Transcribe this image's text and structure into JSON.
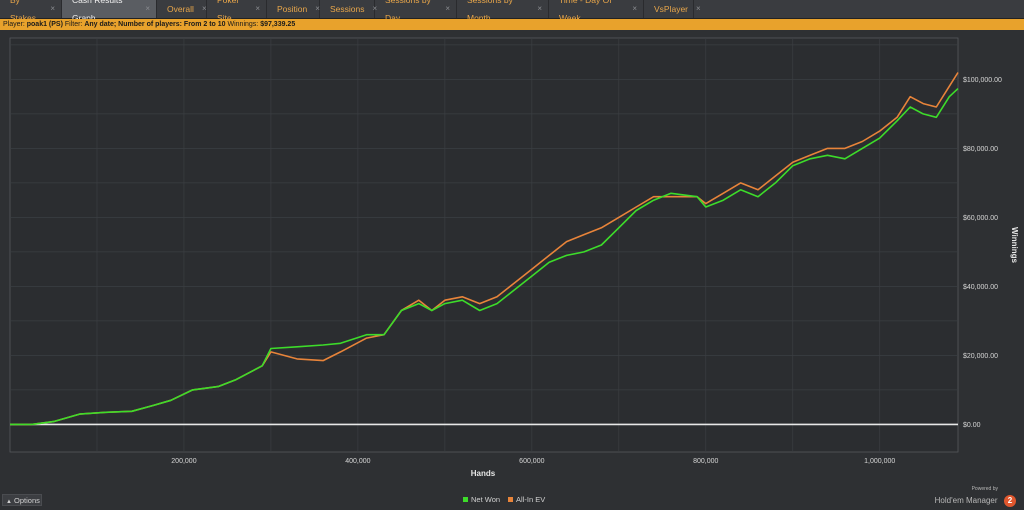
{
  "tabs": [
    {
      "label": "By Stakes",
      "w": 62
    },
    {
      "label": "Cash Results Graph",
      "w": 95,
      "active": true
    },
    {
      "label": "Overall",
      "w": 50
    },
    {
      "label": "Poker Site",
      "w": 60
    },
    {
      "label": "Position",
      "w": 53
    },
    {
      "label": "Sessions",
      "w": 55
    },
    {
      "label": "Sessions by Day",
      "w": 82
    },
    {
      "label": "Sessions by Month",
      "w": 92
    },
    {
      "label": "Time - Day Of Week",
      "w": 95
    },
    {
      "label": "VsPlayer",
      "w": 50
    }
  ],
  "filter": {
    "player_label": "Player:",
    "player": "poak1 (PS)",
    "filter_label": "Filter:",
    "filter_text": "Any date; Number of players: From 2 to 10",
    "winnings_label": "Winnings:",
    "winnings": "$97,339.25"
  },
  "bottom": {
    "options_label": "Options",
    "powered_by": "Powered by",
    "brand_name": "Hold'em Manager",
    "brand_logo": "2"
  },
  "chart_data": {
    "type": "line",
    "title": "",
    "xlabel": "Hands",
    "ylabel": "Winnings",
    "xlim": [
      0,
      1090000
    ],
    "ylim": [
      -8000,
      112000
    ],
    "x_ticks": [
      200000,
      400000,
      600000,
      800000,
      1000000
    ],
    "x_tick_labels": [
      "200,000",
      "400,000",
      "600,000",
      "800,000",
      "1,000,000"
    ],
    "y_ticks": [
      0,
      20000,
      40000,
      60000,
      80000,
      100000
    ],
    "y_tick_labels": [
      "$0.00",
      "$20,000.00",
      "$40,000.00",
      "$60,000.00",
      "$80,000.00",
      "$100,000.00"
    ],
    "grid": true,
    "legend_position": "bottom-center",
    "series": [
      {
        "name": "Net Won",
        "color": "#3ddc2a",
        "x": [
          0,
          25000,
          50000,
          80000,
          110000,
          140000,
          165000,
          185000,
          210000,
          240000,
          260000,
          290000,
          300000,
          330000,
          360000,
          380000,
          410000,
          430000,
          450000,
          470000,
          485000,
          500000,
          520000,
          540000,
          560000,
          580000,
          600000,
          620000,
          640000,
          660000,
          680000,
          700000,
          720000,
          740000,
          760000,
          790000,
          800000,
          820000,
          840000,
          860000,
          880000,
          900000,
          920000,
          940000,
          960000,
          980000,
          1000000,
          1020000,
          1035000,
          1050000,
          1065000,
          1080000,
          1090000
        ],
        "y": [
          0,
          0,
          800,
          3000,
          3500,
          3800,
          5500,
          7000,
          10000,
          11000,
          13000,
          17000,
          22000,
          22500,
          23000,
          23500,
          26000,
          26000,
          33000,
          35000,
          33000,
          35000,
          36000,
          33000,
          35000,
          39000,
          43000,
          47000,
          49000,
          50000,
          52000,
          57000,
          62000,
          65000,
          67000,
          66000,
          63000,
          65000,
          68000,
          66000,
          70000,
          75000,
          77000,
          78000,
          77000,
          80000,
          83000,
          88000,
          92000,
          90000,
          89000,
          95000,
          97339
        ]
      },
      {
        "name": "All-In EV",
        "color": "#e8843a",
        "x": [
          0,
          25000,
          50000,
          80000,
          110000,
          140000,
          165000,
          185000,
          210000,
          240000,
          260000,
          290000,
          300000,
          330000,
          360000,
          380000,
          410000,
          430000,
          450000,
          470000,
          485000,
          500000,
          520000,
          540000,
          560000,
          580000,
          600000,
          620000,
          640000,
          660000,
          680000,
          700000,
          720000,
          740000,
          760000,
          790000,
          800000,
          820000,
          840000,
          860000,
          880000,
          900000,
          920000,
          940000,
          960000,
          980000,
          1000000,
          1020000,
          1035000,
          1050000,
          1065000,
          1080000,
          1090000
        ],
        "y": [
          0,
          0,
          800,
          3000,
          3500,
          3800,
          5500,
          7000,
          10000,
          11000,
          13000,
          17000,
          21000,
          19000,
          18500,
          21000,
          25000,
          26000,
          33000,
          36000,
          33000,
          36000,
          37000,
          35000,
          37000,
          41000,
          45000,
          49000,
          53000,
          55000,
          57000,
          60000,
          63000,
          66000,
          66000,
          66000,
          64000,
          67000,
          70000,
          68000,
          72000,
          76000,
          78000,
          80000,
          80000,
          82000,
          85000,
          89000,
          95000,
          93000,
          92000,
          98000,
          102000
        ]
      }
    ]
  }
}
